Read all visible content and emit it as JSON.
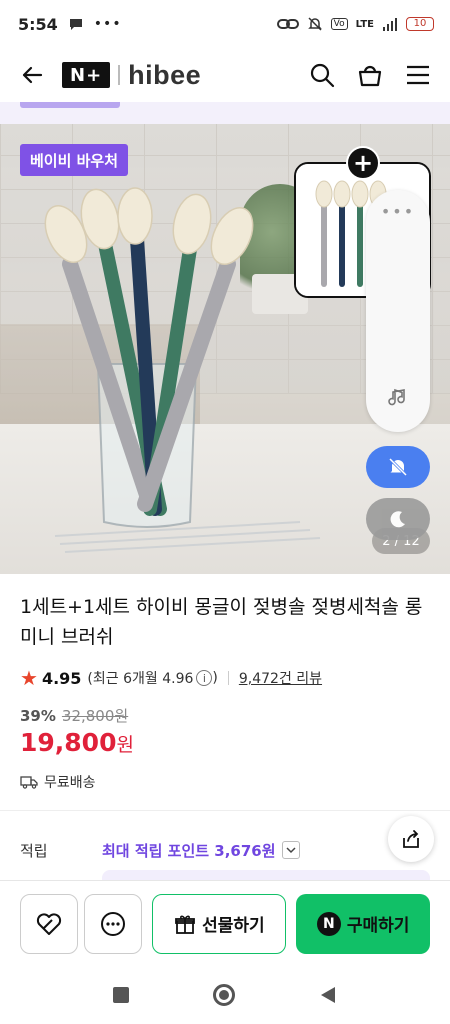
{
  "status_bar": {
    "time": "5:54",
    "signal_label": "LTE",
    "battery": "10"
  },
  "header": {
    "np_logo": "N+",
    "brand": "hibee",
    "icons": [
      "back-arrow-icon",
      "search-icon",
      "basket-icon",
      "menu-icon"
    ]
  },
  "hero": {
    "badge": "베이비 바우처",
    "pager": "2 / 12",
    "float_panel_dots": "•••"
  },
  "product": {
    "title": "1세트+1세트 하이비 몽글이 젖병솔 젖병세척솔 롱미니 브러쉬",
    "rating": "4.95",
    "recent_rating_label": "(최근 6개월 4.96",
    "recent_rating_close": ")",
    "reviews": "9,472건 리뷰",
    "discount_rate": "39%",
    "original_price": "32,800원",
    "price": "19,800",
    "price_unit": "원",
    "shipping": "무료배송"
  },
  "points": {
    "label": "적립",
    "value": "최대 적립 포인트 3,676원"
  },
  "bottom_bar": {
    "gift_label": "선물하기",
    "buy_label": "구매하기",
    "buy_logo": "N"
  },
  "colors": {
    "accent_purple": "#7f52e6",
    "price_red": "#e0213a",
    "naver_green": "#11c067",
    "mute_blue": "#4a7ff0"
  }
}
